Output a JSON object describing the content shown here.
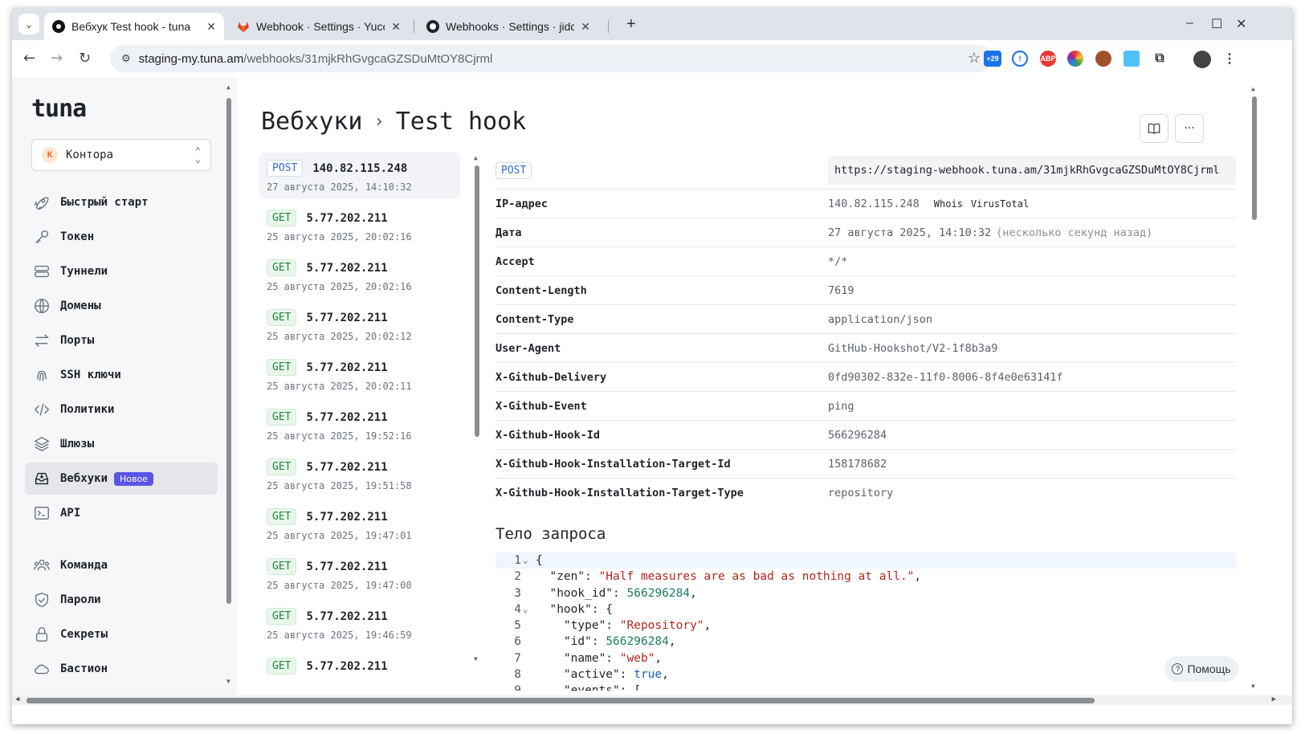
{
  "browser": {
    "tabs": [
      {
        "title": "Вебхук Test hook - tuna",
        "active": true
      },
      {
        "title": "Webhook · Settings · Yucca",
        "active": false
      },
      {
        "title": "Webhooks · Settings · jidckii",
        "active": false
      }
    ],
    "new_tab": "+",
    "url_host": "staging-my.tuna.am",
    "url_path": "/webhooks/31mjkRhGvgcaGZSDuMtOY8Cjrml",
    "ext_badge": "+29"
  },
  "sidebar": {
    "logo": "tuna",
    "org": {
      "initial": "К",
      "name": "Контора"
    },
    "items": [
      {
        "label": "Быстрый старт",
        "icon": "rocket-icon"
      },
      {
        "label": "Токен",
        "icon": "key-icon"
      },
      {
        "label": "Туннели",
        "icon": "server-icon"
      },
      {
        "label": "Домены",
        "icon": "globe-icon"
      },
      {
        "label": "Порты",
        "icon": "arrows-icon"
      },
      {
        "label": "SSH ключи",
        "icon": "fingerprint-icon"
      },
      {
        "label": "Политики",
        "icon": "code-icon"
      },
      {
        "label": "Шлюзы",
        "icon": "layers-icon"
      },
      {
        "label": "Вебхуки",
        "icon": "inbox-icon",
        "badge": "Новое",
        "active": true
      },
      {
        "label": "API",
        "icon": "terminal-icon"
      }
    ],
    "items2": [
      {
        "label": "Команда",
        "icon": "team-icon"
      },
      {
        "label": "Пароли",
        "icon": "shield-icon"
      },
      {
        "label": "Секреты",
        "icon": "lock-icon"
      },
      {
        "label": "Бастион",
        "icon": "cloud-icon"
      }
    ]
  },
  "header": {
    "section": "Вебхуки",
    "separator": "›",
    "title": "Test hook"
  },
  "requests": [
    {
      "method": "POST",
      "ip": "140.82.115.248",
      "date": "27 августа 2025, 14:10:32",
      "selected": true
    },
    {
      "method": "GET",
      "ip": "5.77.202.211",
      "date": "25 августа 2025, 20:02:16"
    },
    {
      "method": "GET",
      "ip": "5.77.202.211",
      "date": "25 августа 2025, 20:02:16"
    },
    {
      "method": "GET",
      "ip": "5.77.202.211",
      "date": "25 августа 2025, 20:02:12"
    },
    {
      "method": "GET",
      "ip": "5.77.202.211",
      "date": "25 августа 2025, 20:02:11"
    },
    {
      "method": "GET",
      "ip": "5.77.202.211",
      "date": "25 августа 2025, 19:52:16"
    },
    {
      "method": "GET",
      "ip": "5.77.202.211",
      "date": "25 августа 2025, 19:51:58"
    },
    {
      "method": "GET",
      "ip": "5.77.202.211",
      "date": "25 августа 2025, 19:47:01"
    },
    {
      "method": "GET",
      "ip": "5.77.202.211",
      "date": "25 августа 2025, 19:47:00"
    },
    {
      "method": "GET",
      "ip": "5.77.202.211",
      "date": "25 августа 2025, 19:46:59"
    },
    {
      "method": "GET",
      "ip": "5.77.202.211",
      "date": ""
    }
  ],
  "detail": {
    "method": "POST",
    "url": "https://staging-webhook.tuna.am/31mjkRhGvgcaGZSDuMtOY8Cjrml",
    "ip_label": "IP-адрес",
    "ip_value": "140.82.115.248",
    "whois": "Whois",
    "virustotal": "VirusTotal",
    "date_label": "Дата",
    "date_value": "27 августа 2025, 14:10:32",
    "date_relative": "(несколько секунд назад)",
    "headers": [
      {
        "k": "Accept",
        "v": "*/*"
      },
      {
        "k": "Content-Length",
        "v": "7619"
      },
      {
        "k": "Content-Type",
        "v": "application/json"
      },
      {
        "k": "User-Agent",
        "v": "GitHub-Hookshot/V2-1f8b3a9"
      },
      {
        "k": "X-Github-Delivery",
        "v": "0fd90302-832e-11f0-8006-8f4e0e63141f"
      },
      {
        "k": "X-Github-Event",
        "v": "ping"
      },
      {
        "k": "X-Github-Hook-Id",
        "v": "566296284"
      },
      {
        "k": "X-Github-Hook-Installation-Target-Id",
        "v": "158178682"
      },
      {
        "k": "X-Github-Hook-Installation-Target-Type",
        "v": "repository"
      }
    ],
    "body_title": "Тело запроса",
    "code_lines": [
      {
        "n": "1",
        "fold": "⌄",
        "tokens": [
          [
            "p",
            "{"
          ]
        ]
      },
      {
        "n": "2",
        "fold": "",
        "tokens": [
          [
            "k",
            "  \"zen\": "
          ],
          [
            "s",
            "\"Half measures are as bad as nothing at all.\""
          ],
          [
            "k",
            ","
          ]
        ]
      },
      {
        "n": "3",
        "fold": "",
        "tokens": [
          [
            "k",
            "  \"hook_id\": "
          ],
          [
            "n",
            "566296284"
          ],
          [
            "k",
            ","
          ]
        ]
      },
      {
        "n": "4",
        "fold": "⌄",
        "tokens": [
          [
            "k",
            "  \"hook\": {"
          ]
        ]
      },
      {
        "n": "5",
        "fold": "",
        "tokens": [
          [
            "k",
            "    \"type\": "
          ],
          [
            "s",
            "\"Repository\""
          ],
          [
            "k",
            ","
          ]
        ]
      },
      {
        "n": "6",
        "fold": "",
        "tokens": [
          [
            "k",
            "    \"id\": "
          ],
          [
            "n",
            "566296284"
          ],
          [
            "k",
            ","
          ]
        ]
      },
      {
        "n": "7",
        "fold": "",
        "tokens": [
          [
            "k",
            "    \"name\": "
          ],
          [
            "s",
            "\"web\""
          ],
          [
            "k",
            ","
          ]
        ]
      },
      {
        "n": "8",
        "fold": "",
        "tokens": [
          [
            "k",
            "    \"active\": "
          ],
          [
            "b",
            "true"
          ],
          [
            "k",
            ","
          ]
        ]
      },
      {
        "n": "9",
        "fold": "⌄",
        "tokens": [
          [
            "k",
            "    \"events\": ["
          ]
        ]
      }
    ]
  },
  "help": "Помощь"
}
